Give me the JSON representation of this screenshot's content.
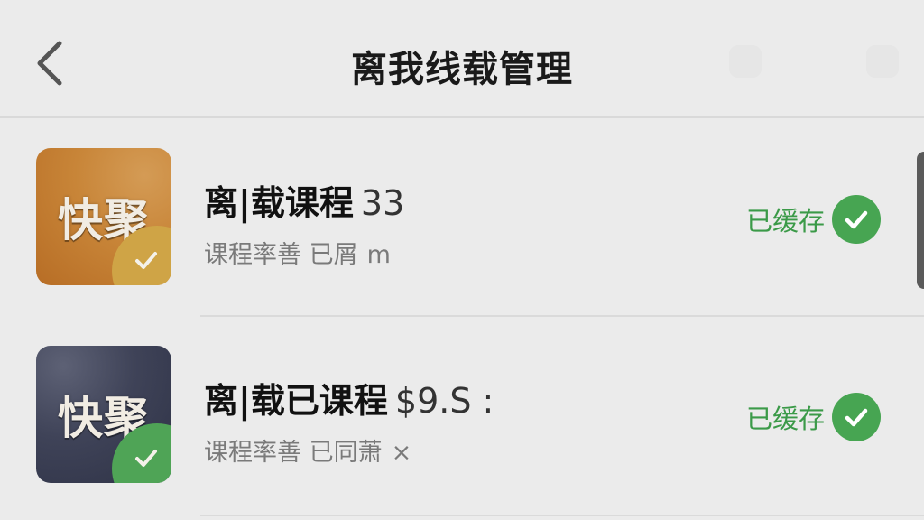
{
  "header": {
    "title": "离我线载管理",
    "back_icon": "chevron-left-icon"
  },
  "courses": [
    {
      "thumb_logo": "快聚",
      "thumb_color": "#c88538",
      "title": "离|载课程",
      "title_extra": "33",
      "subtitle": "课程率善 已屑",
      "subtitle_extra": "m",
      "status_label": "已缓存",
      "status_color": "#47a552"
    },
    {
      "thumb_logo": "快聚",
      "thumb_color": "#3f4358",
      "title": "离|载已课程",
      "title_extra": "$9.S :",
      "subtitle": "课程率善 已同萧",
      "subtitle_extra": "×",
      "status_label": "已缓存",
      "status_color": "#47a552"
    }
  ]
}
